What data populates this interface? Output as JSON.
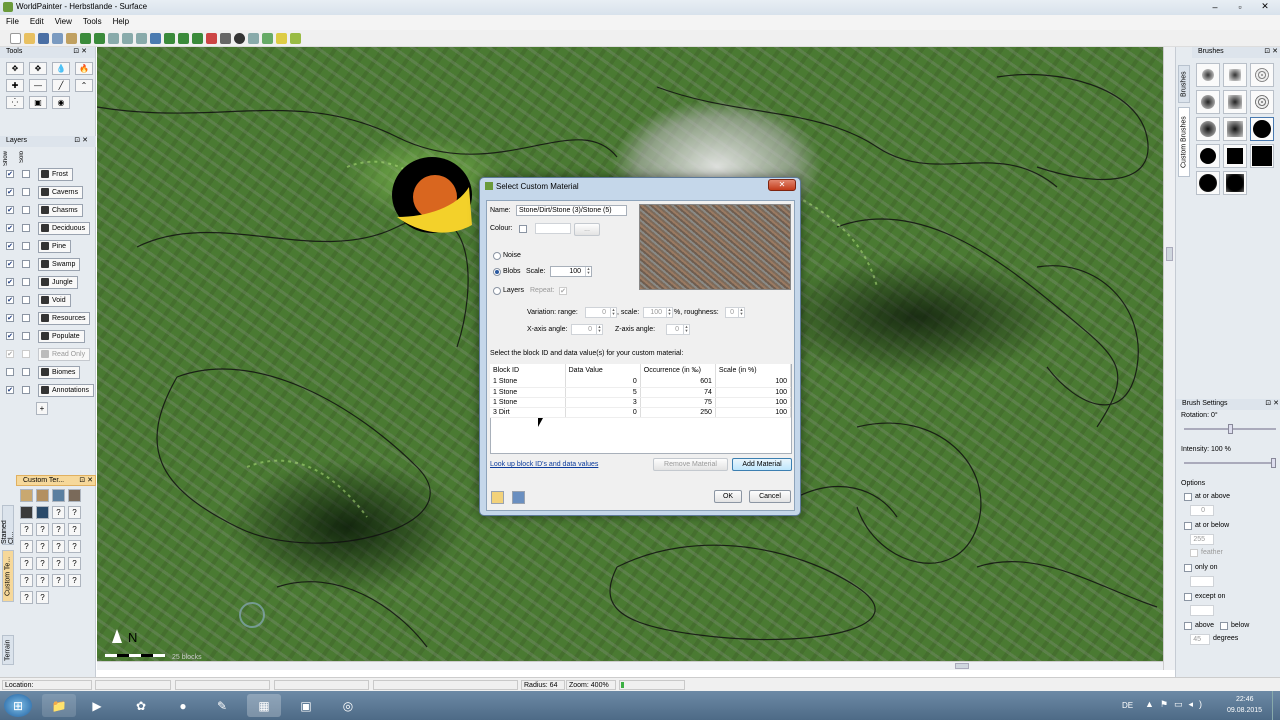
{
  "window": {
    "title": "WorldPainter - Herbstlande - Surface"
  },
  "menu": [
    "File",
    "Edit",
    "View",
    "Tools",
    "Help"
  ],
  "tools_panel": {
    "title": "Tools"
  },
  "layers_panel": {
    "title": "Layers",
    "col_show": "Show",
    "col_solo": "Solo",
    "layers": [
      {
        "label": "Frost",
        "checked": true
      },
      {
        "label": "Caverns",
        "checked": true
      },
      {
        "label": "Chasms",
        "checked": true
      },
      {
        "label": "Deciduous",
        "checked": true
      },
      {
        "label": "Pine",
        "checked": true
      },
      {
        "label": "Swamp",
        "checked": true
      },
      {
        "label": "Jungle",
        "checked": true
      },
      {
        "label": "Void",
        "checked": true
      },
      {
        "label": "Resources",
        "checked": true
      },
      {
        "label": "Populate",
        "checked": true
      },
      {
        "label": "Read Only",
        "checked": true,
        "disabled": true
      },
      {
        "label": "Biomes",
        "checked": false
      },
      {
        "label": "Annotations",
        "checked": true
      }
    ],
    "add_label": "+"
  },
  "custom_terrain_panel": {
    "title": "Custom Ter...",
    "tab_stained": "Stained Cl...",
    "tab_custom": "Custom Te...",
    "tab_terrain": "Terrain"
  },
  "brushes_panel": {
    "title": "Brushes",
    "tab_brushes": "Brushes",
    "tab_custom": "Custom Brushes"
  },
  "brush_settings": {
    "title": "Brush Settings",
    "rotation": "Rotation: 0°",
    "intensity": "Intensity: 100 %",
    "options_label": "Options",
    "at_or_above": "at or above",
    "at_or_above_val": "0",
    "at_or_below": "at or below",
    "at_or_below_val": "255",
    "feather": "feather",
    "only_on": "only on",
    "except_on": "except on",
    "above": "above",
    "below": "below",
    "degrees_val": "45",
    "degrees": "degrees"
  },
  "map": {
    "north": "N",
    "scale_label": "25 blocks"
  },
  "dialog": {
    "title": "Select Custom Material",
    "name_label": "Name:",
    "name_value": "Stone/Dirt/Stone (3)/Stone (5)",
    "colour_label": "Colour:",
    "colour_btn": "...",
    "noise_label": "Noise",
    "blobs_label": "Blobs",
    "scale_label": "Scale:",
    "scale_value": "100",
    "layers_label": "Layers",
    "repeat_label": "Repeat:",
    "variation_label": "Variation: range:",
    "variation_value": "0",
    "scale2_label": ", scale:",
    "scale2_value": "100",
    "roughness_label": "%, roughness:",
    "roughness_value": "0",
    "xangle_label": "X-axis angle:",
    "xangle_value": "0",
    "zangle_label": "Z-axis angle:",
    "zangle_value": "0",
    "instruction": "Select the block ID and data value(s) for your custom material:",
    "columns": [
      "Block ID",
      "Data Value",
      "Occurrence (in ‰)",
      "Scale (in %)"
    ],
    "rows": [
      [
        "1 Stone",
        "0",
        "601",
        "100"
      ],
      [
        "1 Stone",
        "5",
        "74",
        "100"
      ],
      [
        "1 Stone",
        "3",
        "75",
        "100"
      ],
      [
        "3 Dirt",
        "0",
        "250",
        "100"
      ]
    ],
    "lookup_link": "Look up block ID's and data values",
    "remove_btn": "Remove Material",
    "add_btn": "Add Material",
    "ok_btn": "OK",
    "cancel_btn": "Cancel"
  },
  "status": {
    "location": "Location:",
    "radius": "Radius: 64",
    "zoom": "Zoom: 400%",
    "progress": 0.05
  },
  "taskbar": {
    "lang": "DE",
    "time": "22:46",
    "date": "09.08.2015"
  },
  "colors": {
    "accent": "#3c7fb1",
    "map_green": "#4a7a32",
    "close_red": "#c23b1a"
  }
}
